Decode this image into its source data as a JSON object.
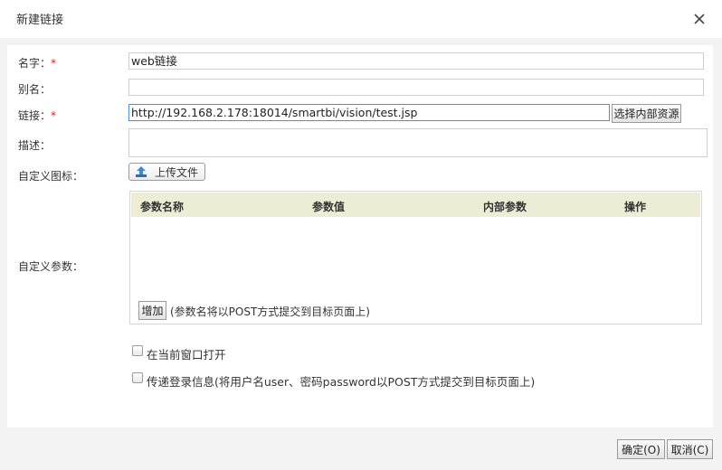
{
  "dialog": {
    "title": "新建链接",
    "close_icon": "close-icon"
  },
  "form": {
    "name": {
      "label": "名字：",
      "required": "*",
      "value": "web链接"
    },
    "alias": {
      "label": "别名：",
      "value": ""
    },
    "link": {
      "label": "链接：",
      "required": "*",
      "value": "http://192.168.2.178:18014/smartbi/vision/test.jsp",
      "choose_button": "选择内部资源"
    },
    "description": {
      "label": "描述：",
      "value": ""
    },
    "custom_icon": {
      "label": "自定义图标：",
      "upload_button": "上传文件",
      "upload_icon": "upload-icon"
    },
    "custom_params": {
      "label": "自定义参数：",
      "columns": [
        "参数名称",
        "参数值",
        "内部参数",
        "操作"
      ],
      "rows": [],
      "add_button": "增加",
      "hint": "(参数名将以POST方式提交到目标页面上)"
    },
    "open_current_window": {
      "label": "在当前窗口打开",
      "checked": false
    },
    "pass_login": {
      "label": "传递登录信息(将用户名user、密码password以POST方式提交到目标页面上)",
      "checked": false
    }
  },
  "footer": {
    "ok_button": "确定(O)",
    "cancel_button": "取消(C)"
  }
}
